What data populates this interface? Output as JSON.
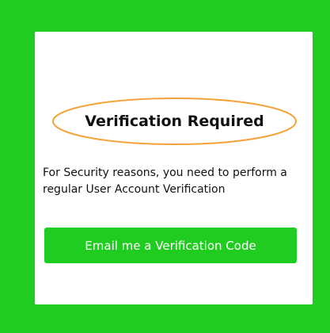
{
  "card": {
    "title": "Verification Required",
    "message": "For Security reasons, you need to perform a regular User Account Verification",
    "button_label": "Email me a Verification Code"
  },
  "colors": {
    "background": "#1fcc1f",
    "card": "#ffffff",
    "ellipse_outline": "#f2a33a",
    "button": "#1fcc1f",
    "button_text": "#ffffff",
    "text": "#111111"
  }
}
